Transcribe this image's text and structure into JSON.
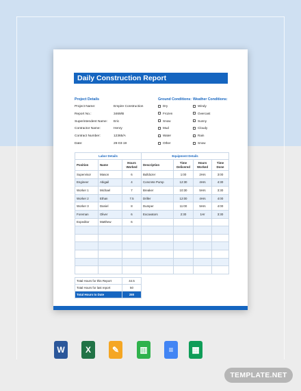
{
  "document": {
    "title": "Daily Construction Report",
    "project_details": {
      "heading": "Project Details",
      "fields": [
        {
          "label": "Project Name:",
          "value": "Empire Construction"
        },
        {
          "label": "Report No.:",
          "value": "3469/B"
        },
        {
          "label": "Superintendent Name:",
          "value": "Eric"
        },
        {
          "label": "Contractor Name:",
          "value": "Henry"
        },
        {
          "label": "Contract Number:",
          "value": "12365/A"
        },
        {
          "label": "Date:",
          "value": "29-03-19"
        }
      ]
    },
    "ground_conditions": {
      "heading": "Ground Conditions:",
      "options": [
        "Dry",
        "Frozen",
        "Snow",
        "Mud",
        "Water",
        "Other"
      ]
    },
    "weather_conditions": {
      "heading": "Weather Conditions:",
      "options": [
        "Windy",
        "Overcast",
        "Sunny",
        "Cloudy",
        "Rain",
        "Snow"
      ]
    },
    "labor": {
      "heading": "Labor Details",
      "columns": [
        "Position",
        "Name",
        "Hours Worked"
      ],
      "rows": [
        [
          "Supervisor",
          "Mason",
          "6"
        ],
        [
          "Engineer",
          "Abigail",
          "4"
        ],
        [
          "Worker 1",
          "Michael",
          "7"
        ],
        [
          "Worker 2",
          "Ethan",
          "7.5"
        ],
        [
          "Worker 3",
          "Daniel",
          "8"
        ],
        [
          "Foreman",
          "Oliver",
          "6"
        ],
        [
          "Expeditor",
          "Matthew",
          "6"
        ]
      ]
    },
    "equipment": {
      "heading": "Equipment Details",
      "columns": [
        "Description",
        "Time Delivered",
        "Hours Worked",
        "Time Done"
      ],
      "rows": [
        [
          "Bulldozer",
          "1:00",
          "2Hrs",
          "3:00"
        ],
        [
          "Concrete Pump",
          "12:30",
          "4Hrs",
          "4:30"
        ],
        [
          "Breaker",
          "10:30",
          "5Hrs",
          "3:30"
        ],
        [
          "Driller",
          "12:00",
          "4Hrs",
          "4:00"
        ],
        [
          "Dumper",
          "11:00",
          "5Hrs",
          "4:00"
        ],
        [
          "Excavators",
          "2:30",
          "1Hr",
          "3:30"
        ]
      ]
    },
    "summary": [
      {
        "label": "Total Hours for this Report",
        "value": "44.5"
      },
      {
        "label": "Total Hours for last report",
        "value": "50"
      },
      {
        "label": "Total Hours to Date",
        "value": "280"
      }
    ]
  },
  "app_icons": [
    {
      "name": "word-icon",
      "glyph": "W",
      "color": "#2b579a"
    },
    {
      "name": "excel-icon",
      "glyph": "X",
      "color": "#217346"
    },
    {
      "name": "pages-icon",
      "glyph": "✎",
      "color": "#f5a623"
    },
    {
      "name": "numbers-icon",
      "glyph": "▥",
      "color": "#2fb24c"
    },
    {
      "name": "google-docs-icon",
      "glyph": "≡",
      "color": "#4285f4"
    },
    {
      "name": "google-sheets-icon",
      "glyph": "▦",
      "color": "#0f9d58"
    }
  ],
  "brand": {
    "text": "TEMPLATE.NET"
  }
}
